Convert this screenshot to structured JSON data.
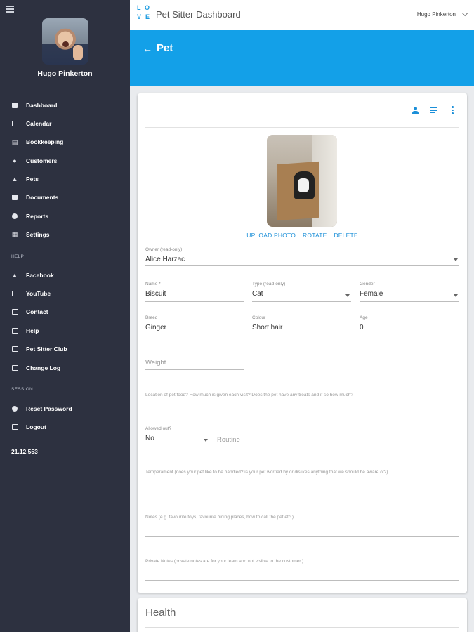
{
  "sidebar": {
    "user_name": "Hugo Pinkerton",
    "items": [
      {
        "label": "Dashboard",
        "icon": "dashboard-icon"
      },
      {
        "label": "Calendar",
        "icon": "calendar-icon"
      },
      {
        "label": "Bookkeeping",
        "icon": "bank-icon"
      },
      {
        "label": "Customers",
        "icon": "person-icon"
      },
      {
        "label": "Pets",
        "icon": "paw-icon"
      },
      {
        "label": "Documents",
        "icon": "documents-icon"
      },
      {
        "label": "Reports",
        "icon": "reports-icon"
      },
      {
        "label": "Settings",
        "icon": "settings-icon"
      }
    ],
    "help_label": "HELP",
    "help_items": [
      {
        "label": "Facebook",
        "icon": "thumbs-up-icon"
      },
      {
        "label": "YouTube",
        "icon": "video-icon"
      },
      {
        "label": "Contact",
        "icon": "external-link-icon"
      },
      {
        "label": "Help",
        "icon": "external-link-icon"
      },
      {
        "label": "Pet Sitter Club",
        "icon": "external-link-icon"
      },
      {
        "label": "Change Log",
        "icon": "external-link-icon"
      }
    ],
    "session_label": "SESSION",
    "session_items": [
      {
        "label": "Reset Password",
        "icon": "lock-icon"
      },
      {
        "label": "Logout",
        "icon": "logout-icon"
      }
    ],
    "version": "21.12.553"
  },
  "topbar": {
    "logo_letters": [
      "L",
      "O",
      "V",
      "E"
    ],
    "title": "Pet Sitter Dashboard",
    "user": "Hugo Pinkerton"
  },
  "header": {
    "back_arrow": "←",
    "title": "Pet"
  },
  "photo_actions": {
    "upload": "UPLOAD PHOTO",
    "rotate": "ROTATE",
    "delete": "DELETE"
  },
  "form": {
    "owner": {
      "label": "Owner (read-only)",
      "value": "Alice Harzac"
    },
    "name": {
      "label": "Name *",
      "value": "Biscuit"
    },
    "type": {
      "label": "Type (read-only)",
      "value": "Cat"
    },
    "gender": {
      "label": "Gender",
      "value": "Female"
    },
    "breed": {
      "label": "Breed",
      "value": "Ginger"
    },
    "colour": {
      "label": "Colour",
      "value": "Short hair"
    },
    "age": {
      "label": "Age",
      "value": "0"
    },
    "weight": {
      "placeholder": "Weight"
    },
    "food": {
      "label": "Location of pet food? How much is given each visit? Does the pet have any treats and if so how much?"
    },
    "allowed_out": {
      "label": "Allowed out?",
      "value": "No"
    },
    "routine": {
      "placeholder": "Routine"
    },
    "temperament": {
      "label": "Temperament (does your pet like to be handled? is your pet worried by or dislikes anything that we should be aware of?)"
    },
    "notes": {
      "label": "Notes (e.g. favourite toys, favourite hiding places, how to call the pet etc.)"
    },
    "private_notes": {
      "label": "Private Notes (private notes are for your team and not visible to the customer.)"
    }
  },
  "health": {
    "title": "Health"
  },
  "colors": {
    "sidebar": "#2d3140",
    "accent": "#13a0e8",
    "link": "#1b8fd8"
  }
}
